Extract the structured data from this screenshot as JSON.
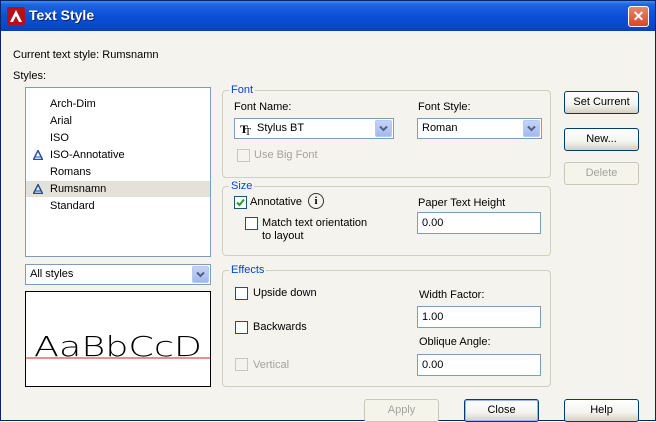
{
  "window": {
    "title": "Text Style",
    "close_label": "✕"
  },
  "current_style": {
    "label": "Current text style:",
    "value": "Rumsnamn"
  },
  "styles_label": "Styles:",
  "styles": [
    {
      "label": "Arch-Dim",
      "annotative": false,
      "selected": false
    },
    {
      "label": "Arial",
      "annotative": false,
      "selected": false
    },
    {
      "label": "ISO",
      "annotative": false,
      "selected": false
    },
    {
      "label": "ISO-Annotative",
      "annotative": true,
      "selected": false
    },
    {
      "label": "Romans",
      "annotative": false,
      "selected": false
    },
    {
      "label": "Rumsnamn",
      "annotative": true,
      "selected": true
    },
    {
      "label": "Standard",
      "annotative": false,
      "selected": false
    }
  ],
  "filter": {
    "value": "All styles"
  },
  "preview": {
    "text": "AaBbCcD"
  },
  "font": {
    "group_title": "Font",
    "name_label": "Font Name:",
    "name_value": "Stylus BT",
    "style_label": "Font Style:",
    "style_value": "Roman",
    "big_font_label": "Use Big Font",
    "big_font_checked": false
  },
  "size": {
    "group_title": "Size",
    "annotative_label": "Annotative",
    "annotative_checked": true,
    "info_glyph": "i",
    "match_label_1": "Match text orientation",
    "match_label_2": "to layout",
    "match_checked": false,
    "height_label": "Paper Text Height",
    "height_value": "0.00"
  },
  "effects": {
    "group_title": "Effects",
    "upside_down_label": "Upside down",
    "backwards_label": "Backwards",
    "vertical_label": "Vertical",
    "width_label": "Width Factor:",
    "width_value": "1.00",
    "oblique_label": "Oblique Angle:",
    "oblique_value": "0.00"
  },
  "buttons": {
    "set_current": "Set Current",
    "new": "New...",
    "delete": "Delete",
    "apply": "Apply",
    "close": "Close",
    "help": "Help"
  },
  "colors": {
    "title_bar": "#0b4fd8",
    "group_title": "#0046d5",
    "preview_baseline": "#d81e1e"
  }
}
